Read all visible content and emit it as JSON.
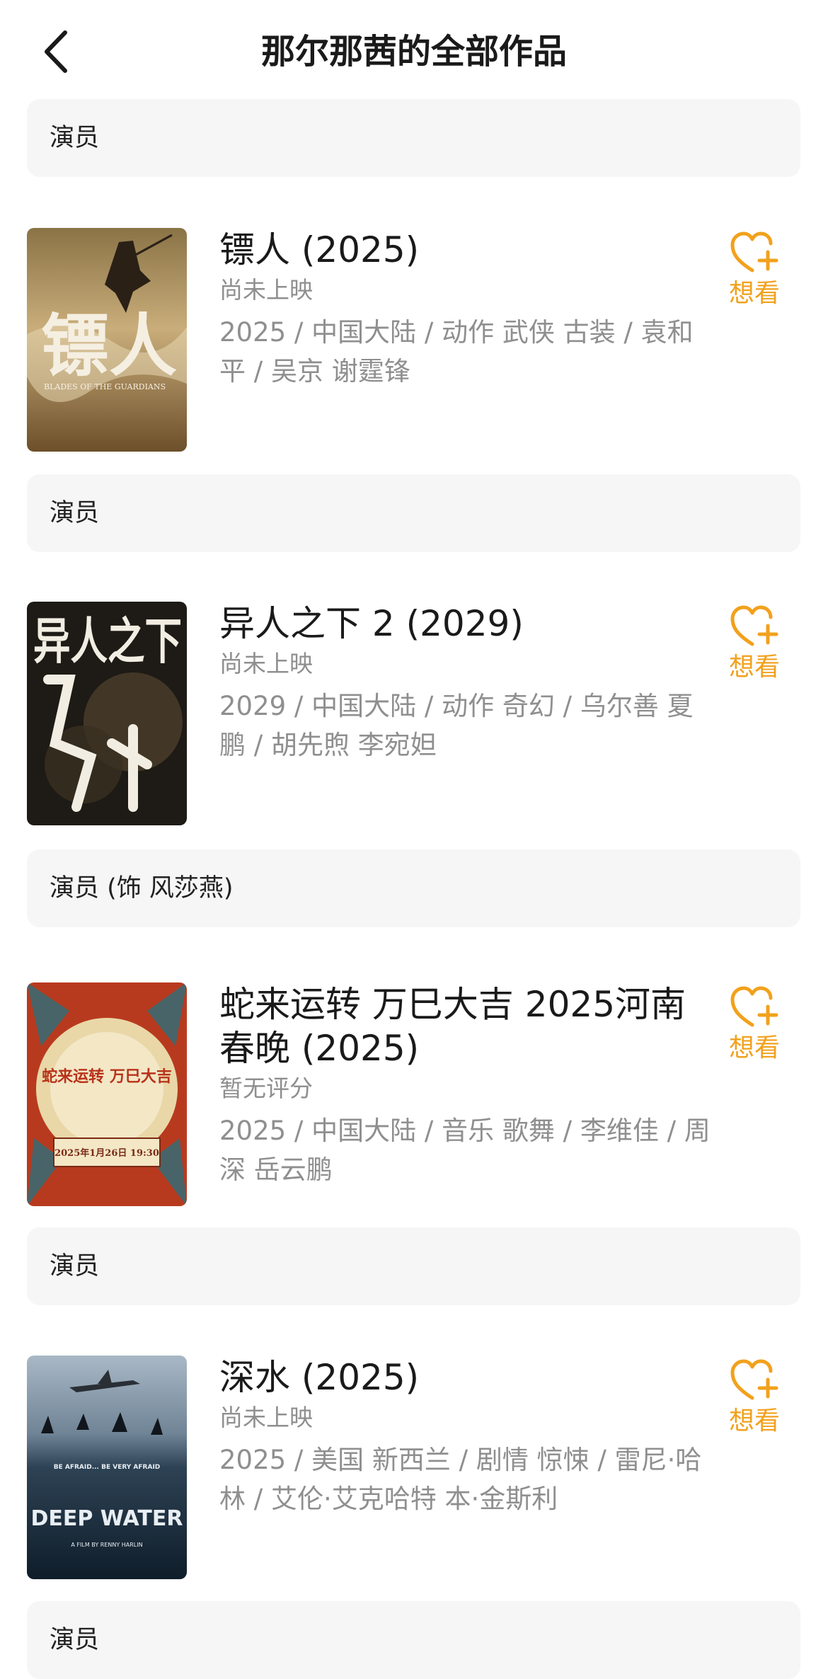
{
  "header": {
    "title": "那尔那茜的全部作品"
  },
  "sections": [
    {
      "role": "演员"
    },
    {
      "role": "演员"
    },
    {
      "role": "演员 (饰 风莎燕)"
    },
    {
      "role": "演员"
    },
    {
      "role": "演员"
    }
  ],
  "works": [
    {
      "title": "镖人 (2025)",
      "status": "尚未上映",
      "meta": "2025 / 中国大陆 / 动作 武侠 古装 / 袁和平 / 吴京 谢霆锋",
      "want_label": "想看",
      "poster": {
        "text": "镖人",
        "subtext": "BLADES OF THE GUARDIANS"
      }
    },
    {
      "title": "异人之下 2 (2029)",
      "status": "尚未上映",
      "meta": "2029 / 中国大陆 / 动作 奇幻 / 乌尔善 夏鹏 / 胡先煦 李宛妲",
      "want_label": "想看",
      "poster": {
        "text": "异人之下"
      }
    },
    {
      "title": "蛇来运转 万巳大吉 2025河南春晚 (2025)",
      "status": "暂无评分",
      "meta": "2025 / 中国大陆 / 音乐 歌舞 / 李维佳 / 周深 岳云鹏",
      "want_label": "想看",
      "poster": {
        "text": "蛇来运转 万巳大吉",
        "subtext": "2025年1月26日 19:30"
      }
    },
    {
      "title": "深水 (2025)",
      "status": "尚未上映",
      "meta": "2025 / 美国 新西兰 / 剧情 惊悚 / 雷尼·哈林 / 艾伦·艾克哈特 本·金斯利",
      "want_label": "想看",
      "poster": {
        "text": "DEEP WATER",
        "subtext": "BE AFRAID... BE VERY AFRAID",
        "credit": "A FILM BY RENNY HARLIN"
      }
    }
  ],
  "colors": {
    "accent": "#f2a11d",
    "section_bg": "#f6f6f6",
    "muted_text": "#8f8f8f"
  },
  "icons": {
    "back": "chevron-left-icon",
    "want": "heart-plus-icon"
  }
}
